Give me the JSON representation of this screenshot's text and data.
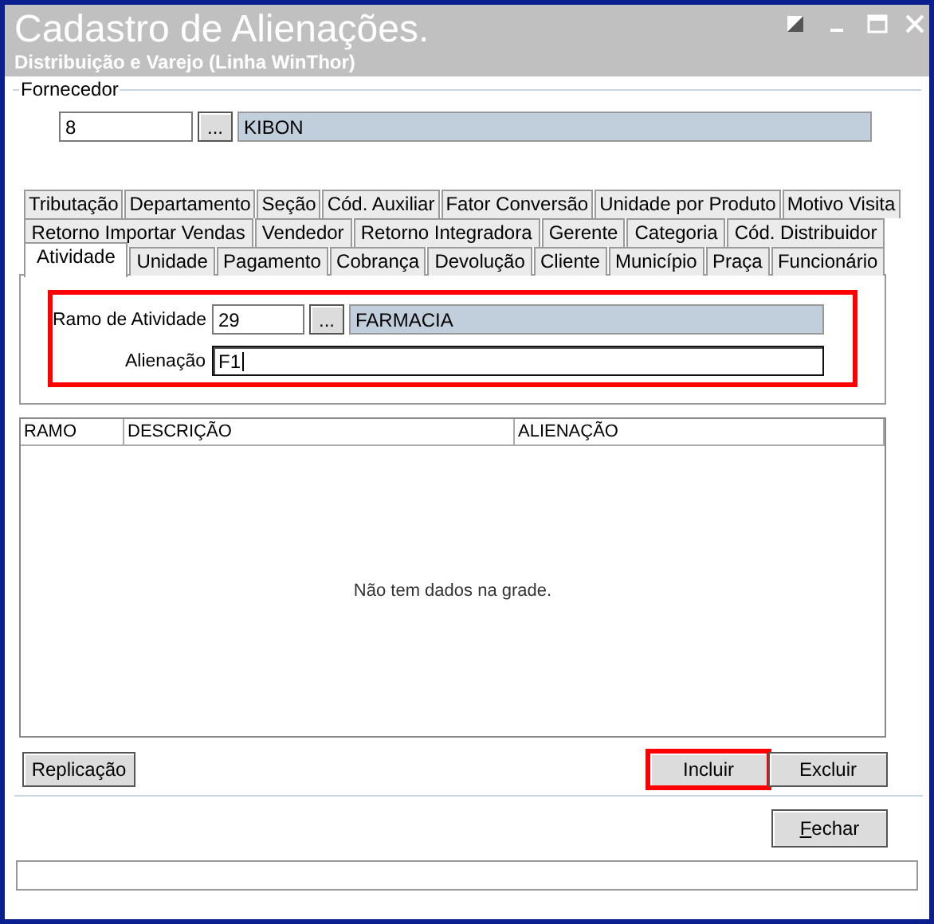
{
  "window": {
    "title": "Cadastro de Alienações.",
    "subtitle": "Distribuição e Varejo (Linha WinThor)"
  },
  "fornecedor": {
    "legend": "Fornecedor",
    "code": "8",
    "lookup_button": "...",
    "name": "KIBON"
  },
  "tab_rows": [
    {
      "tabs": [
        {
          "label": "Tributação",
          "selected": false
        },
        {
          "label": "Departamento",
          "selected": false
        },
        {
          "label": "Seção",
          "selected": false
        },
        {
          "label": "Cód. Auxiliar",
          "selected": false
        },
        {
          "label": "Fator Conversão",
          "selected": false
        },
        {
          "label": "Unidade por Produto",
          "selected": false
        },
        {
          "label": "Motivo Visita",
          "selected": false
        }
      ]
    },
    {
      "tabs": [
        {
          "label": "Retorno Importar Vendas",
          "selected": false
        },
        {
          "label": "Vendedor",
          "selected": false
        },
        {
          "label": "Retorno Integradora",
          "selected": false
        },
        {
          "label": "Gerente",
          "selected": false
        },
        {
          "label": "Categoria",
          "selected": false
        },
        {
          "label": "Cód. Distribuidor",
          "selected": false
        }
      ]
    },
    {
      "tabs": [
        {
          "label": "Atividade",
          "selected": true
        },
        {
          "label": "Unidade",
          "selected": false
        },
        {
          "label": "Pagamento",
          "selected": false
        },
        {
          "label": "Cobrança",
          "selected": false
        },
        {
          "label": "Devolução",
          "selected": false
        },
        {
          "label": "Cliente",
          "selected": false
        },
        {
          "label": "Município",
          "selected": false
        },
        {
          "label": "Praça",
          "selected": false
        },
        {
          "label": "Funcionário",
          "selected": false
        }
      ]
    }
  ],
  "activity": {
    "highlighted": true,
    "fields": [
      {
        "kind": "lookup",
        "label": "Ramo de Atividade",
        "value": "29",
        "button": "...",
        "name": "FARMACIA",
        "focused": false
      },
      {
        "kind": "text",
        "label": "Alienação",
        "value": "F1",
        "focused": true
      }
    ]
  },
  "grid": {
    "columns": [
      "RAMO",
      "DESCRIÇÃO",
      "ALIENAÇÃO"
    ],
    "empty_message": "Não tem dados na grade."
  },
  "buttons": [
    {
      "label": "Replicação",
      "highlighted": false
    },
    {
      "label": "Incluir",
      "highlighted": true
    },
    {
      "label": "Excluir",
      "highlighted": false
    }
  ],
  "close_button": {
    "label": "Fechar",
    "mnemonic": true
  }
}
